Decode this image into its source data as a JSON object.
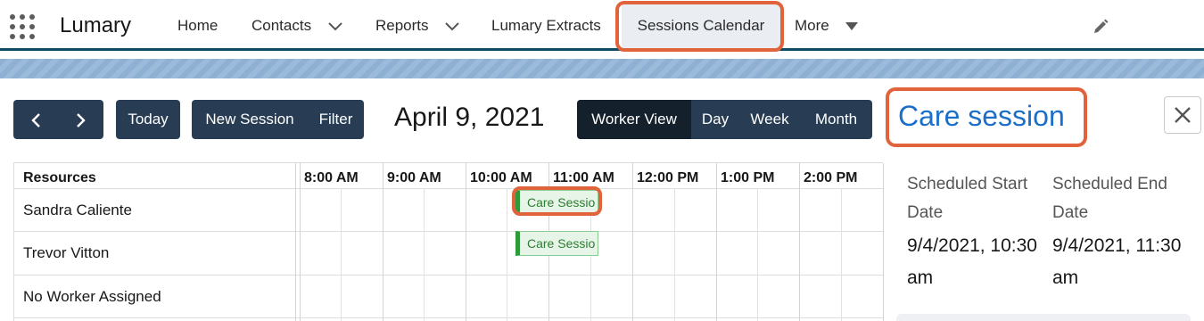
{
  "nav": {
    "app_name": "Lumary",
    "items": [
      {
        "label": "Home"
      },
      {
        "label": "Contacts"
      },
      {
        "label": "Reports"
      },
      {
        "label": "Lumary Extracts"
      },
      {
        "label": "Sessions Calendar"
      },
      {
        "label": "More"
      }
    ],
    "active": "Sessions Calendar"
  },
  "toolbar": {
    "prev_glyph": "‹",
    "next_glyph": "›",
    "today_label": "Today",
    "new_session_label": "New Session",
    "filter_label": "Filter",
    "date_title": "April 9, 2021",
    "views": [
      "Worker View",
      "Day",
      "Week",
      "Month"
    ],
    "active_view": "Worker View"
  },
  "grid": {
    "resources_header": "Resources",
    "resources": [
      "Sandra Caliente",
      "Trevor Vitton",
      "No Worker Assigned"
    ],
    "time_slots": [
      "8:00 AM",
      "9:00 AM",
      "10:00 AM",
      "11:00 AM",
      "12:00 PM",
      "1:00 PM",
      "2:00 PM"
    ],
    "events": [
      {
        "label": "Care Sessio",
        "resource": "Sandra Caliente"
      },
      {
        "label": "Care Sessio",
        "resource": "Trevor Vitton"
      }
    ]
  },
  "panel": {
    "title": "Care session",
    "close_glyph": "✕",
    "start_label": "Scheduled Start Date",
    "start_value": "9/4/2021, 10:30 am",
    "end_label": "Scheduled End Date",
    "end_value": "9/4/2021, 11:30 am"
  },
  "colors": {
    "nav_underline": "#0d4a66",
    "button_bg": "#283d54",
    "active_view_bg": "#15202d",
    "highlight": "#e0633b",
    "title_link": "#1b6fc9",
    "event_bg": "#e6f5e7",
    "event_accent": "#2e9a3c"
  },
  "icons": {
    "app_launcher": "grid-dots-icon",
    "dropdown": "chevron-down-icon",
    "more_dropdown": "caret-down-icon",
    "edit": "pencil-icon",
    "close": "close-icon"
  }
}
